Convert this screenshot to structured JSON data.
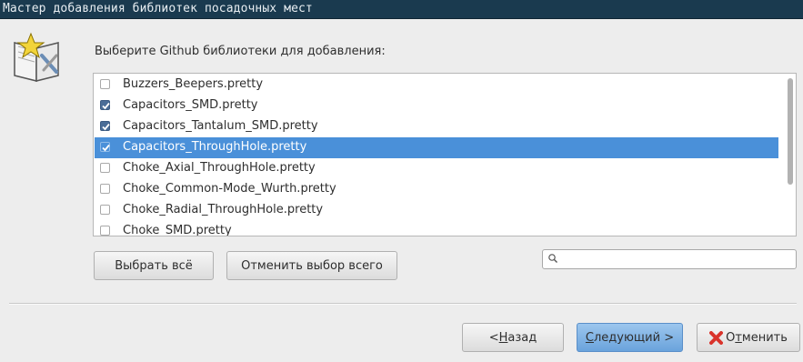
{
  "window": {
    "title": "Мастер добавления библиотек посадочных мест"
  },
  "header": {
    "prompt": "Выберите Github библиотеки для добавления:"
  },
  "libraries": [
    {
      "name": "Buzzers_Beepers.pretty",
      "checked": false,
      "selected": false
    },
    {
      "name": "Capacitors_SMD.pretty",
      "checked": true,
      "selected": false
    },
    {
      "name": "Capacitors_Tantalum_SMD.pretty",
      "checked": true,
      "selected": false
    },
    {
      "name": "Capacitors_ThroughHole.pretty",
      "checked": true,
      "selected": true
    },
    {
      "name": "Choke_Axial_ThroughHole.pretty",
      "checked": false,
      "selected": false
    },
    {
      "name": "Choke_Common-Mode_Wurth.pretty",
      "checked": false,
      "selected": false
    },
    {
      "name": "Choke_Radial_ThroughHole.pretty",
      "checked": false,
      "selected": false
    },
    {
      "name": "Choke_SMD.pretty",
      "checked": false,
      "selected": false
    }
  ],
  "selection_buttons": {
    "select_all": "Выбрать всё",
    "unselect_all": "Отменить выбор всего"
  },
  "search": {
    "value": ""
  },
  "nav": {
    "back_prefix": "< ",
    "back_mnemonic": "Н",
    "back_rest": "азад",
    "next_mnemonic": "С",
    "next_rest": "ледующий >",
    "cancel_prefix": "О",
    "cancel_mnemonic": "т",
    "cancel_rest": "менить"
  },
  "colors": {
    "titlebar": "#1a3a4f",
    "selection": "#4a90d9",
    "primary_button": "#7fb2e5",
    "cancel_icon": "#d9332b"
  }
}
